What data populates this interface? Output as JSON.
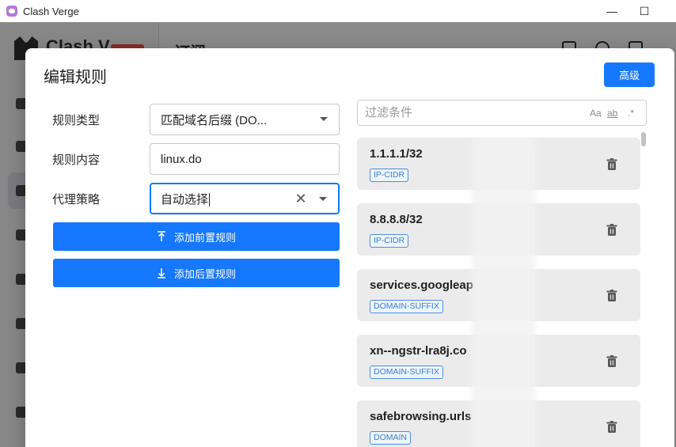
{
  "window": {
    "title": "Clash Verge",
    "minimize_glyph": "—",
    "maximize_glyph": "☐"
  },
  "background_app": {
    "brand": "Clash V",
    "heading": "订阅"
  },
  "dialog": {
    "title": "编辑规则",
    "advanced_button": "高级",
    "form": {
      "rule_type_label": "规则类型",
      "rule_type_value": "匹配域名后缀 (DO...",
      "rule_content_label": "规则内容",
      "rule_content_value": "linux.do",
      "proxy_policy_label": "代理策略",
      "proxy_policy_value": "自动选择"
    },
    "add_prepend_button": "添加前置规则",
    "add_append_button": "添加后置规则",
    "filter": {
      "placeholder": "过滤条件",
      "match_case": "Aa",
      "match_word": "ab",
      "regex": ".*"
    },
    "rules": [
      {
        "name": "1.1.1.1/32",
        "type": "IP-CIDR"
      },
      {
        "name": "8.8.8.8/32",
        "type": "IP-CIDR"
      },
      {
        "name": "services.googleap",
        "type": "DOMAIN-SUFFIX"
      },
      {
        "name": "xn--ngstr-lra8j.co",
        "type": "DOMAIN-SUFFIX"
      },
      {
        "name": "safebrowsing.urls",
        "type": "DOMAIN"
      }
    ]
  },
  "colors": {
    "accent": "#1677ff",
    "tag_border": "#4a8fe0",
    "rule_bg": "#ebebeb"
  }
}
